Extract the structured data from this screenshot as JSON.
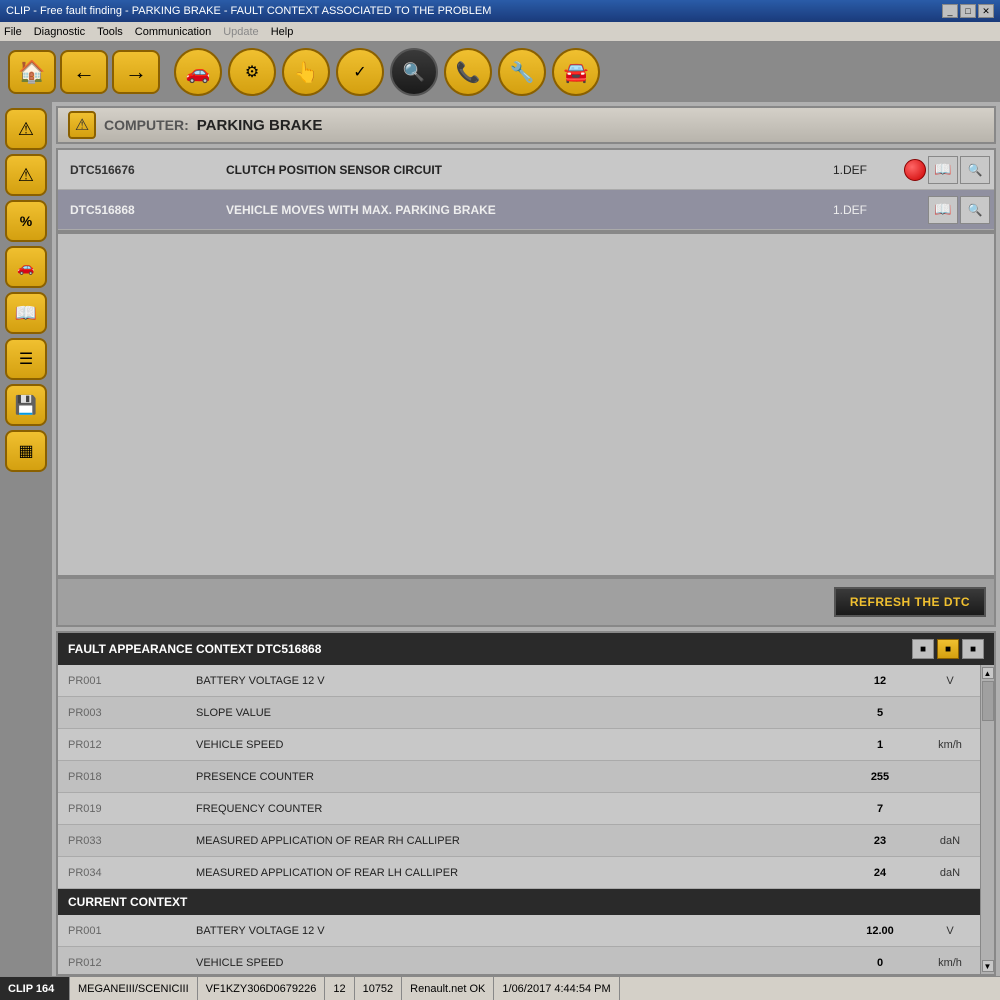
{
  "title_bar": {
    "text": "CLIP - Free fault finding - PARKING BRAKE - FAULT CONTEXT ASSOCIATED TO THE PROBLEM",
    "controls": [
      "_",
      "□",
      "✕"
    ]
  },
  "menu": {
    "items": [
      "File",
      "Diagnostic",
      "Tools",
      "Communication",
      "Update",
      "Help"
    ]
  },
  "toolbar": {
    "nav_back": "←",
    "nav_forward": "→",
    "nav_home": "⌂",
    "icons": [
      {
        "name": "car-icon",
        "symbol": "🚗",
        "active": false
      },
      {
        "name": "transmission-icon",
        "symbol": "⚙",
        "active": false
      },
      {
        "name": "touch-icon",
        "symbol": "👆",
        "active": false
      },
      {
        "name": "checklist-icon",
        "symbol": "✓",
        "active": false
      },
      {
        "name": "search-fault-icon",
        "symbol": "🔍",
        "active": true
      },
      {
        "name": "phone-icon",
        "symbol": "📞",
        "active": false
      },
      {
        "name": "wrench-icon",
        "symbol": "🔧",
        "active": false
      },
      {
        "name": "car-check-icon",
        "symbol": "🚘",
        "active": false
      }
    ]
  },
  "side_toolbar": {
    "buttons": [
      {
        "name": "warning-btn",
        "symbol": "⚠",
        "label": "warning"
      },
      {
        "name": "warning2-btn",
        "symbol": "⚠",
        "label": "warning2"
      },
      {
        "name": "percent-btn",
        "symbol": "%",
        "label": "percent"
      },
      {
        "name": "car-btn",
        "symbol": "🚗",
        "label": "car"
      },
      {
        "name": "book-btn",
        "symbol": "📖",
        "label": "book"
      },
      {
        "name": "list-btn",
        "symbol": "☰",
        "label": "list"
      },
      {
        "name": "save-btn",
        "symbol": "💾",
        "label": "save"
      },
      {
        "name": "barcode-btn",
        "symbol": "▦",
        "label": "barcode"
      }
    ]
  },
  "computer_header": {
    "label": "COMPUTER:",
    "name": "PARKING BRAKE"
  },
  "dtc_table": {
    "rows": [
      {
        "code": "DTC516676",
        "description": "CLUTCH POSITION SENSOR CIRCUIT",
        "status": "1.DEF",
        "has_red_dot": true,
        "selected": false
      },
      {
        "code": "DTC516868",
        "description": "VEHICLE MOVES WITH MAX. PARKING BRAKE",
        "status": "1.DEF",
        "has_red_dot": false,
        "selected": true
      }
    ]
  },
  "refresh_btn_label": "REFRESH THE DTC",
  "fault_context": {
    "header": "FAULT APPEARANCE CONTEXT DTC516868",
    "context_buttons": [
      "■",
      "■",
      "■"
    ],
    "rows": [
      {
        "pr": "PR001",
        "description": "BATTERY VOLTAGE 12 V",
        "value": "12",
        "unit": "V"
      },
      {
        "pr": "PR003",
        "description": "SLOPE VALUE",
        "value": "5",
        "unit": ""
      },
      {
        "pr": "PR012",
        "description": "VEHICLE SPEED",
        "value": "1",
        "unit": "km/h"
      },
      {
        "pr": "PR018",
        "description": "PRESENCE COUNTER",
        "value": "255",
        "unit": ""
      },
      {
        "pr": "PR019",
        "description": "FREQUENCY COUNTER",
        "value": "7",
        "unit": ""
      },
      {
        "pr": "PR033",
        "description": "MEASURED APPLICATION OF REAR RH CALLIPER",
        "value": "23",
        "unit": "daN"
      },
      {
        "pr": "PR034",
        "description": "MEASURED APPLICATION OF REAR LH CALLIPER",
        "value": "24",
        "unit": "daN"
      }
    ]
  },
  "current_context": {
    "header": "CURRENT CONTEXT",
    "rows": [
      {
        "pr": "PR001",
        "description": "BATTERY VOLTAGE 12 V",
        "value": "12.00",
        "unit": "V"
      },
      {
        "pr": "PR012",
        "description": "VEHICLE SPEED",
        "value": "0",
        "unit": "km/h"
      }
    ]
  },
  "status_bar": {
    "clip": "CLIP 164",
    "vehicle": "MEGANEIII/SCENICIII",
    "vin": "VF1KZY306D0679226",
    "number": "12",
    "code": "10752",
    "network": "Renault.net OK",
    "datetime": "1/06/2017 4:44:54 PM"
  }
}
